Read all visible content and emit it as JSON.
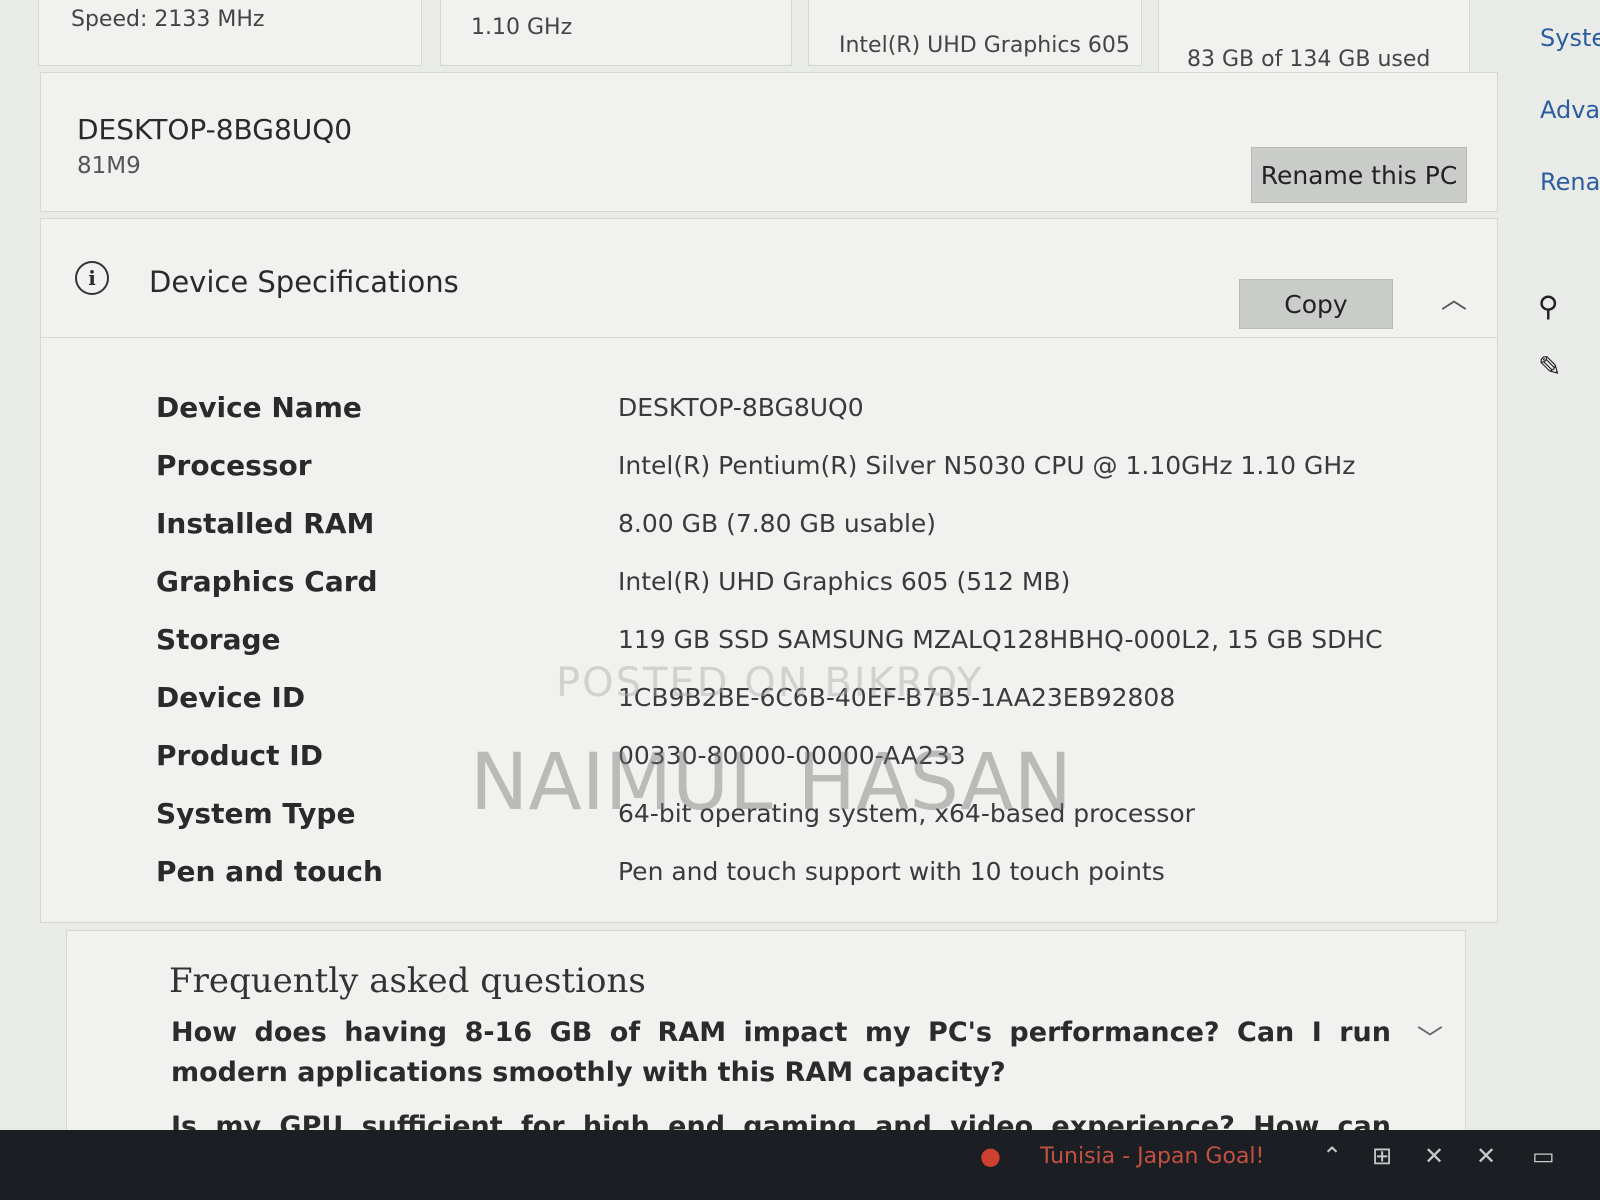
{
  "top_stats": [
    "Speed: 2133 MHz",
    "1.10 GHz",
    "Intel(R) UHD Graphics 605",
    "83 GB of 134 GB used"
  ],
  "device": {
    "name": "DESKTOP-8BG8UQ0",
    "model": "81M9",
    "rename_label": "Rename this PC"
  },
  "specs": {
    "title": "Device Specifications",
    "copy_label": "Copy",
    "rows": [
      {
        "label": "Device Name",
        "value": "DESKTOP-8BG8UQ0"
      },
      {
        "label": "Processor",
        "value": "Intel(R) Pentium(R) Silver N5030 CPU @ 1.10GHz   1.10 GHz"
      },
      {
        "label": "Installed RAM",
        "value": "8.00 GB (7.80 GB usable)"
      },
      {
        "label": "Graphics Card",
        "value": "Intel(R) UHD Graphics 605 (512 MB)"
      },
      {
        "label": "Storage",
        "value": "119 GB SSD SAMSUNG MZALQ128HBHQ-000L2, 15 GB SDHC"
      },
      {
        "label": "Device ID",
        "value": "1CB9B2BE-6C6B-40EF-B7B5-1AA23EB92808"
      },
      {
        "label": "Product ID",
        "value": "00330-80000-00000-AA233"
      },
      {
        "label": "System Type",
        "value": "64-bit operating system, x64-based processor"
      },
      {
        "label": "Pen and touch",
        "value": "Pen and touch support with 10 touch points"
      }
    ]
  },
  "faq": {
    "title": "Frequently asked questions",
    "questions": [
      "How does having 8-16 GB of RAM impact my PC's performance? Can I run modern applications smoothly with this RAM capacity?",
      "Is my GPU sufficient for high end gaming and video experience? How can having a"
    ]
  },
  "right_links": [
    "Syste",
    "Advar",
    "Renar"
  ],
  "watermarks": {
    "top": "POSTED ON BIKROY",
    "main": "NAIMUL HASAN"
  },
  "taskbar": {
    "news": "Tunisia - Japan Goal!"
  }
}
